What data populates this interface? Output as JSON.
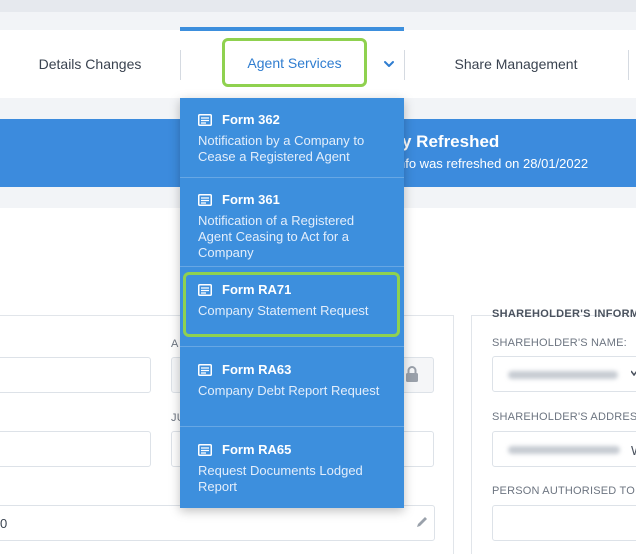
{
  "tabs": {
    "details_changes": "Details Changes",
    "agent_services": "Agent Services",
    "share_management": "Share Management"
  },
  "banner": {
    "title_fragment": "y Refreshed",
    "subtitle_fragment": "nfo was refreshed on 28/01/2022"
  },
  "dropdown": {
    "items": [
      {
        "title": "Form 362",
        "desc": "Notification by a Company to Cease a Registered Agent"
      },
      {
        "title": "Form 361",
        "desc": "Notification of a Registered Agent Ceasing to Act for a Company"
      },
      {
        "title": "Form RA71",
        "desc": "Company Statement Request"
      },
      {
        "title": "Form RA63",
        "desc": "Company Debt Report Request"
      },
      {
        "title": "Form RA65",
        "desc": "Request Documents Lodged Report"
      }
    ]
  },
  "form": {
    "label_a_fragment": "A",
    "label_ju_fragment": "JU",
    "value_zero": "0"
  },
  "shareholder_panel": {
    "title": "SHAREHOLDER'S INFORMA",
    "name_label": "SHAREHOLDER'S NAME:",
    "address_label": "SHAREHOLDER'S ADDRESS:",
    "address_value_fragment": "W",
    "authorised_label": "PERSON AUTHORISED TO SIG"
  },
  "colors": {
    "accent": "#3d8fdd",
    "highlight": "#8fd14f"
  }
}
